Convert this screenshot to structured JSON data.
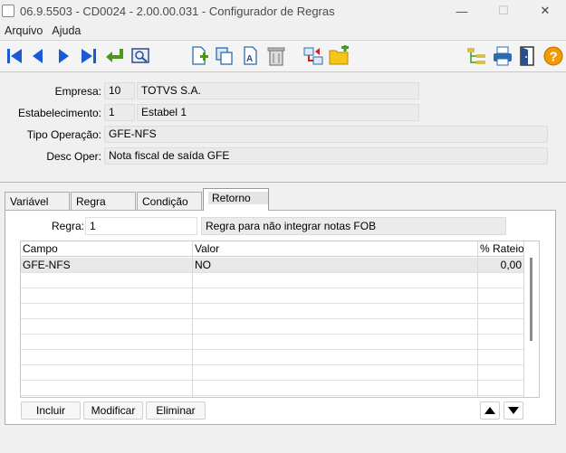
{
  "window": {
    "title": "06.9.5503 - CD0024 - 2.00.00.031 - Configurador de Regras",
    "minimize": "—",
    "maximize": "☐",
    "close": "✕"
  },
  "menu": {
    "items": [
      "Arquivo",
      "Ajuda"
    ]
  },
  "toolbar": {
    "icons": [
      "first-record-icon",
      "previous-record-icon",
      "next-record-icon",
      "last-record-icon",
      "goto-icon",
      "search-icon",
      "new-icon",
      "copy-icon",
      "edit-icon",
      "delete-icon",
      "network-icon",
      "new-folder-icon",
      "tree-icon",
      "print-icon",
      "exit-icon",
      "help-icon"
    ]
  },
  "header": {
    "empresa_label": "Empresa:",
    "empresa_code": "10",
    "empresa_name": "TOTVS S.A.",
    "estab_label": "Estabelecimento:",
    "estab_code": "1",
    "estab_name": "Estabel 1",
    "tipo_label": "Tipo Operação:",
    "tipo_value": "GFE-NFS",
    "desc_label": "Desc Oper:",
    "desc_value": "Nota fiscal de saída GFE"
  },
  "tabs": [
    "Variável",
    "Regra",
    "Condição",
    "Retorno"
  ],
  "active_tab": "Retorno",
  "retorno": {
    "regra_label": "Regra:",
    "regra_value": "1",
    "regra_desc": "Regra para não integrar notas FOB",
    "columns": [
      "Campo",
      "Valor",
      "% Rateio"
    ],
    "rows": [
      {
        "campo": "GFE-NFS",
        "valor": "NO",
        "rateio": "0,00"
      }
    ],
    "buttons": {
      "incluir": "Incluir",
      "modificar": "Modificar",
      "eliminar": "Eliminar"
    }
  },
  "colors": {
    "nav_blue": "#1a5ad7",
    "green": "#4a9a1a",
    "help_orange": "#f29a00",
    "folder_yellow": "#f5c518"
  }
}
